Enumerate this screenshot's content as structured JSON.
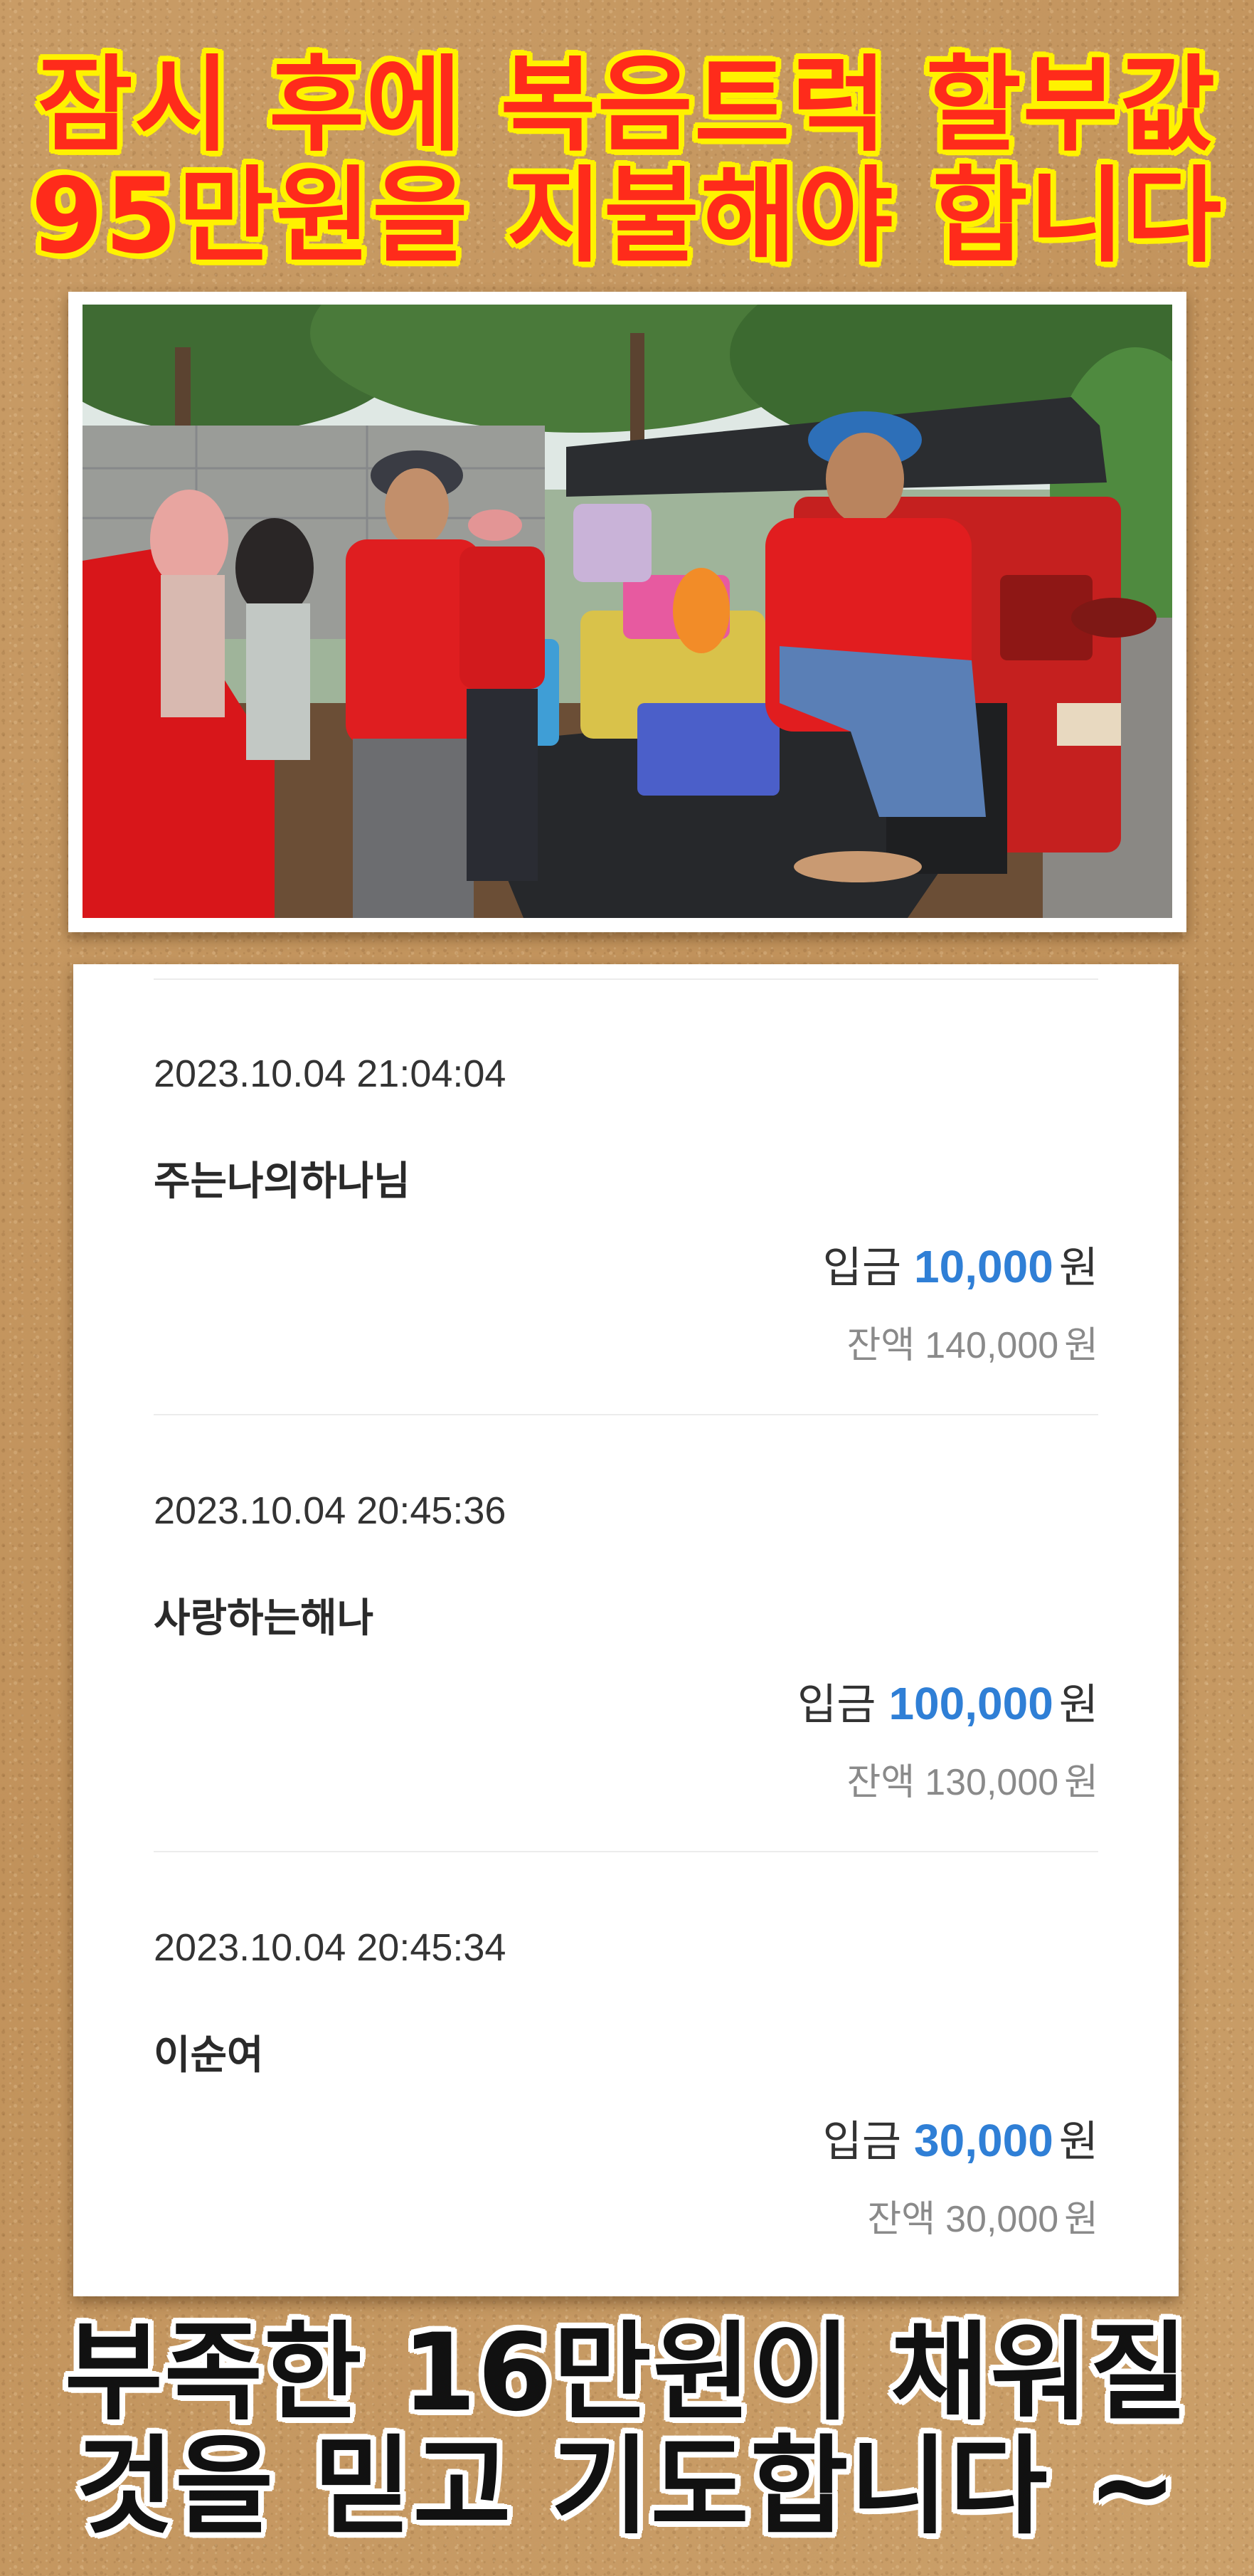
{
  "headline_top": {
    "line1": "잠시 후에 복음트럭 할부값",
    "line2": "95만원을 지불해야 합니다"
  },
  "headline_bottom": {
    "line1": "부족한 16만원이 채워질",
    "line2": "것을 믿고 기도합니다 ~"
  },
  "colors": {
    "headline_top_fill": "#ff2b1b",
    "headline_top_outline": "#fff200",
    "headline_bottom_fill": "#111111",
    "headline_bottom_outline": "#ffffff",
    "amount_accent": "#2f7fd6",
    "background": "#c79a63"
  },
  "transactions": [
    {
      "datetime": "2023.10.04 21:04:04",
      "name": "주는나의하나님",
      "deposit_label": "입금",
      "deposit_amount": "10,000",
      "deposit_unit": "원",
      "balance_label": "잔액",
      "balance_amount": "140,000",
      "balance_unit": "원"
    },
    {
      "datetime": "2023.10.04 20:45:36",
      "name": "사랑하는해나",
      "deposit_label": "입금",
      "deposit_amount": "100,000",
      "deposit_unit": "원",
      "balance_label": "잔액",
      "balance_amount": "130,000",
      "balance_unit": "원"
    },
    {
      "datetime": "2023.10.04 20:45:34",
      "name": "이순여",
      "deposit_label": "입금",
      "deposit_amount": "30,000",
      "deposit_unit": "원",
      "balance_label": "잔액",
      "balance_amount": "30,000",
      "balance_unit": "원"
    }
  ]
}
